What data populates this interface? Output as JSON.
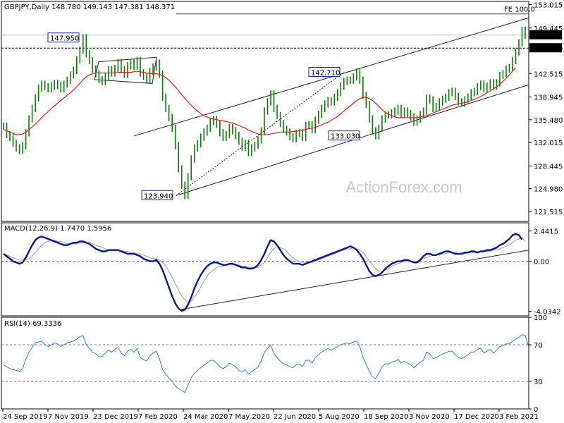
{
  "header": {
    "symbol_line": "GBPJPY,Daily  148.780 149.143 147.381 148.371"
  },
  "watermark": "ActionForex.com",
  "colors": {
    "price": "#0b7a08",
    "ma": "#e02020",
    "macd": "#0a1a8a",
    "signal": "#a0a0a0",
    "rsi": "#2f7fd8",
    "box_fill": "#1a2b8c"
  },
  "chart_data": [
    {
      "type": "line",
      "title": "GBPJPY,Daily",
      "ohlc_header": {
        "open": 148.78,
        "high": 149.143,
        "low": 147.381,
        "close": 148.371
      },
      "ylim": [
        120.0,
        153.5
      ],
      "y_ticks": [
        "153.015",
        "149.445",
        "146.390",
        "142.515",
        "138.945",
        "135.480",
        "132.015",
        "128.445",
        "124.980",
        "121.515"
      ],
      "x_ticks": [
        "24 Sep 2019",
        "7 Nov 2019",
        "23 Dec 2019",
        "7 Feb 2020",
        "24 Mar 2020",
        "7 May 2020",
        "22 Jun 2020",
        "5 Aug 2020",
        "18 Sep 2020",
        "3 Nov 2020",
        "17 Dec 2020",
        "3 Feb 2021"
      ],
      "series": [
        {
          "values": [
            134.5,
            133.2,
            132.8,
            131.9,
            131.2,
            130.8,
            131.5,
            133.5,
            135.6,
            137.2,
            138.8,
            140.3,
            140.9,
            140.5,
            140.2,
            140.6,
            141.0,
            140.7,
            140.2,
            140.9,
            141.5,
            142.3,
            143.0,
            144.6,
            146.1,
            147.95,
            145.5,
            144.5,
            143.2,
            142.5,
            141.6,
            141.3,
            142.1,
            143.1,
            142.6,
            143.3,
            144.2,
            143.1,
            142.4,
            143.7,
            144.2,
            143.6,
            144.5,
            142.6,
            142.1,
            141.6,
            142.8,
            143.5,
            144.1,
            142.4,
            138.9,
            137.2,
            135.8,
            134.2,
            131.5,
            128.0,
            125.5,
            123.94,
            126.8,
            129.5,
            131.2,
            131.8,
            132.8,
            133.6,
            134.2,
            135.2,
            135.5,
            134.8,
            133.5,
            132.8,
            133.2,
            134.3,
            133.8,
            133.1,
            132.2,
            131.3,
            131.9,
            130.5,
            131.2,
            131.6,
            132.4,
            133.8,
            136.8,
            138.2,
            139.4,
            137.2,
            136.1,
            134.9,
            134.0,
            133.6,
            132.9,
            132.6,
            133.4,
            133.5,
            132.8,
            134.6,
            134.7,
            134.0,
            135.4,
            136.3,
            137.2,
            137.9,
            138.4,
            138.2,
            138.9,
            139.6,
            140.6,
            141.3,
            141.5,
            141.5,
            142.0,
            142.71,
            141.5,
            139.2,
            137.8,
            135.6,
            133.8,
            133.03,
            134.2,
            135.6,
            136.2,
            136.2,
            136.5,
            136.8,
            137.2,
            136.3,
            136.8,
            136.4,
            135.9,
            135.1,
            135.6,
            136.3,
            136.8,
            138.8,
            138.5,
            137.2,
            137.5,
            138.2,
            138.6,
            138.9,
            139.6,
            139.8,
            139.0,
            138.2,
            138.0,
            138.5,
            138.9,
            139.6,
            139.8,
            140.5,
            140.9,
            140.2,
            140.6,
            141.1,
            140.6,
            141.1,
            142.2,
            142.5,
            143.2,
            143.4,
            144.5,
            145.8,
            147.2,
            149.1,
            148.371
          ]
        },
        {
          "values": [
            134.0,
            133.8,
            133.6,
            133.4,
            133.2,
            133.2,
            133.3,
            133.6,
            134.0,
            134.4,
            134.8,
            135.3,
            135.8,
            136.3,
            136.7,
            137.2,
            137.6,
            138.0,
            138.4,
            138.8,
            139.2,
            139.6,
            140.0,
            140.5,
            141.0,
            141.6,
            142.0,
            142.3,
            142.5,
            142.6,
            142.6,
            142.6,
            142.6,
            142.6,
            142.6,
            142.6,
            142.7,
            142.7,
            142.7,
            142.7,
            142.7,
            142.8,
            142.8,
            142.8,
            142.7,
            142.6,
            142.5,
            142.5,
            142.5,
            142.4,
            142.2,
            141.9,
            141.5,
            141.0,
            140.5,
            139.9,
            139.3,
            138.7,
            138.2,
            137.7,
            137.2,
            136.8,
            136.4,
            136.1,
            135.9,
            135.7,
            135.6,
            135.5,
            135.4,
            135.3,
            135.2,
            135.1,
            135.0,
            134.8,
            134.6,
            134.4,
            134.2,
            133.9,
            133.7,
            133.5,
            133.3,
            133.2,
            133.2,
            133.2,
            133.3,
            133.4,
            133.5,
            133.6,
            133.6,
            133.6,
            133.6,
            133.7,
            133.7,
            133.8,
            133.9,
            134.0,
            134.1,
            134.2,
            134.3,
            134.5,
            134.7,
            134.9,
            135.1,
            135.4,
            135.7,
            136.0,
            136.4,
            136.8,
            137.2,
            137.6,
            138.0,
            138.4,
            138.7,
            138.9,
            138.9,
            138.7,
            138.4,
            138.0,
            137.5,
            137.0,
            136.6,
            136.3,
            136.1,
            135.9,
            135.8,
            135.8,
            135.8,
            135.8,
            135.8,
            135.8,
            135.8,
            135.9,
            136.0,
            136.1,
            136.3,
            136.5,
            136.7,
            136.9,
            137.1,
            137.3,
            137.5,
            137.7,
            137.8,
            137.9,
            138.0,
            138.1,
            138.2,
            138.4,
            138.6,
            138.8,
            139.0,
            139.3,
            139.6,
            139.9,
            140.2,
            140.5,
            140.9,
            141.3,
            141.8,
            142.3,
            142.9,
            143.4
          ]
        }
      ],
      "annotations": {
        "labels": [
          "147.950",
          "142.710",
          "133.030",
          "123.940",
          "FE 100.0"
        ],
        "current_price": "148.371",
        "reference_price": "146.390"
      }
    },
    {
      "type": "line",
      "title": "MACD(12,26,9) 1.7470 1.5956",
      "ylim": [
        -4.4,
        3.1
      ],
      "y_ticks": [
        "2.4415",
        "0.00",
        "-4.0342"
      ],
      "series": [
        {
          "values": [
            0.6,
            0.4,
            0.2,
            0.0,
            -0.1,
            -0.2,
            -0.1,
            0.3,
            0.8,
            1.3,
            1.7,
            1.9,
            2.0,
            1.9,
            1.8,
            1.7,
            1.6,
            1.5,
            1.4,
            1.3,
            1.3,
            1.4,
            1.5,
            1.5,
            1.6,
            1.6,
            1.5,
            1.4,
            1.2,
            1.0,
            0.9,
            0.8,
            0.8,
            0.9,
            0.9,
            0.9,
            0.9,
            0.8,
            0.7,
            0.6,
            0.6,
            0.6,
            0.5,
            0.4,
            0.2,
            0.1,
            0.0,
            0.0,
            0.1,
            -0.2,
            -0.7,
            -1.4,
            -2.1,
            -2.8,
            -3.4,
            -3.8,
            -4.0,
            -3.9,
            -3.5,
            -2.9,
            -2.2,
            -1.6,
            -1.1,
            -0.7,
            -0.4,
            -0.2,
            -0.1,
            -0.1,
            -0.2,
            -0.3,
            -0.3,
            -0.2,
            -0.2,
            -0.3,
            -0.4,
            -0.5,
            -0.5,
            -0.6,
            -0.6,
            -0.5,
            -0.3,
            0.1,
            0.6,
            1.2,
            1.7,
            1.6,
            1.3,
            0.9,
            0.5,
            0.2,
            0.0,
            -0.2,
            -0.2,
            -0.2,
            -0.3,
            -0.2,
            -0.1,
            0.0,
            0.1,
            0.2,
            0.3,
            0.4,
            0.5,
            0.6,
            0.7,
            0.8,
            0.9,
            1.0,
            1.1,
            1.2,
            1.1,
            0.9,
            0.6,
            0.2,
            -0.3,
            -0.8,
            -1.1,
            -1.2,
            -1.1,
            -0.9,
            -0.6,
            -0.4,
            -0.2,
            -0.1,
            0.0,
            0.0,
            0.1,
            0.1,
            0.0,
            -0.1,
            -0.1,
            0.1,
            0.4,
            0.6,
            0.6,
            0.5,
            0.5,
            0.6,
            0.7,
            0.8,
            0.8,
            0.7,
            0.6,
            0.6,
            0.6,
            0.7,
            0.7,
            0.8,
            0.8,
            0.7,
            0.8,
            0.8,
            0.9,
            0.9,
            1.0,
            1.1,
            1.3,
            1.4,
            1.6,
            1.8,
            2.1,
            2.2,
            2.1,
            1.75
          ]
        },
        {
          "values": [
            0.6,
            0.5,
            0.4,
            0.3,
            0.2,
            0.1,
            0.1,
            0.1,
            0.2,
            0.4,
            0.7,
            1.0,
            1.3,
            1.5,
            1.6,
            1.7,
            1.7,
            1.6,
            1.6,
            1.5,
            1.4,
            1.4,
            1.4,
            1.4,
            1.5,
            1.5,
            1.5,
            1.5,
            1.4,
            1.3,
            1.2,
            1.1,
            1.0,
            0.9,
            0.9,
            0.9,
            0.9,
            0.9,
            0.8,
            0.8,
            0.7,
            0.7,
            0.6,
            0.6,
            0.5,
            0.4,
            0.3,
            0.2,
            0.2,
            0.1,
            -0.1,
            -0.4,
            -0.8,
            -1.3,
            -1.8,
            -2.3,
            -2.8,
            -3.1,
            -3.3,
            -3.2,
            -2.9,
            -2.5,
            -2.1,
            -1.6,
            -1.2,
            -0.9,
            -0.7,
            -0.5,
            -0.4,
            -0.4,
            -0.3,
            -0.3,
            -0.3,
            -0.3,
            -0.3,
            -0.4,
            -0.4,
            -0.5,
            -0.5,
            -0.5,
            -0.5,
            -0.3,
            -0.1,
            0.3,
            0.7,
            1.0,
            1.2,
            1.1,
            1.0,
            0.8,
            0.5,
            0.3,
            0.1,
            0.0,
            -0.1,
            -0.1,
            -0.1,
            -0.1,
            0.0,
            0.1,
            0.2,
            0.3,
            0.4,
            0.5,
            0.6,
            0.7,
            0.8,
            0.9,
            1.0,
            1.0,
            1.1,
            1.0,
            0.9,
            0.7,
            0.4,
            0.0,
            -0.3,
            -0.6,
            -0.8,
            -0.8,
            -0.7,
            -0.6,
            -0.4,
            -0.3,
            -0.2,
            -0.1,
            0.0,
            0.0,
            0.0,
            0.0,
            0.0,
            0.1,
            0.2,
            0.3,
            0.4,
            0.5,
            0.5,
            0.5,
            0.6,
            0.6,
            0.7,
            0.7,
            0.7,
            0.6,
            0.6,
            0.6,
            0.7,
            0.7,
            0.7,
            0.7,
            0.8,
            0.8,
            0.8,
            0.8,
            0.9,
            0.9,
            1.0,
            1.1,
            1.2,
            1.3,
            1.5,
            1.7,
            1.8,
            1.9,
            1.6
          ]
        }
      ]
    },
    {
      "type": "line",
      "title": "RSI(14) 69.3336",
      "ylim": [
        0,
        100
      ],
      "y_ticks": [
        "100",
        "70",
        "30",
        "0"
      ],
      "series": [
        {
          "values": [
            48,
            46,
            44,
            43,
            42,
            41,
            44,
            54,
            62,
            67,
            72,
            73,
            74,
            70,
            68,
            70,
            72,
            71,
            68,
            70,
            72,
            73,
            74,
            76,
            79,
            80,
            70,
            66,
            62,
            60,
            57,
            57,
            61,
            64,
            62,
            65,
            67,
            61,
            58,
            63,
            65,
            62,
            66,
            56,
            54,
            52,
            58,
            61,
            63,
            55,
            43,
            38,
            34,
            30,
            25,
            22,
            20,
            18,
            26,
            34,
            39,
            42,
            45,
            48,
            50,
            53,
            53,
            50,
            46,
            44,
            46,
            50,
            48,
            46,
            42,
            40,
            43,
            38,
            41,
            43,
            46,
            52,
            62,
            66,
            70,
            60,
            56,
            52,
            49,
            48,
            46,
            45,
            48,
            49,
            46,
            53,
            53,
            50,
            56,
            59,
            62,
            64,
            66,
            64,
            66,
            68,
            70,
            71,
            72,
            71,
            73,
            74,
            68,
            56,
            49,
            41,
            35,
            33,
            39,
            46,
            49,
            49,
            51,
            52,
            54,
            50,
            52,
            50,
            48,
            45,
            48,
            51,
            53,
            62,
            60,
            55,
            56,
            58,
            60,
            61,
            63,
            63,
            59,
            56,
            55,
            57,
            59,
            62,
            62,
            65,
            66,
            61,
            63,
            65,
            61,
            64,
            68,
            69,
            71,
            71,
            74,
            76,
            78,
            81,
            80,
            69
          ]
        }
      ]
    }
  ]
}
